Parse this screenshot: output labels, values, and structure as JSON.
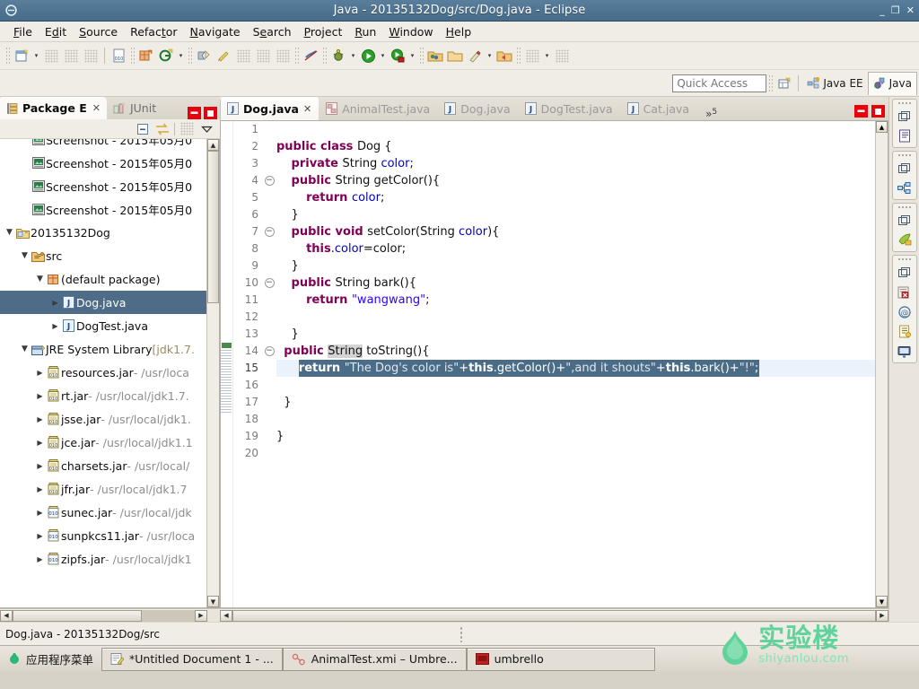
{
  "window": {
    "title": "Java - 20135132Dog/src/Dog.java - Eclipse",
    "app_icon": "eclipse-icon",
    "buttons": {
      "minimize": "_",
      "restore": "❐",
      "close": "✕"
    }
  },
  "menubar": {
    "items": [
      {
        "label": "File",
        "mnemonic": "F"
      },
      {
        "label": "Edit",
        "mnemonic": "E"
      },
      {
        "label": "Source",
        "mnemonic": "S"
      },
      {
        "label": "Refactor",
        "mnemonic": "R"
      },
      {
        "label": "Navigate",
        "mnemonic": "N"
      },
      {
        "label": "Search",
        "mnemonic": "e"
      },
      {
        "label": "Project",
        "mnemonic": "P"
      },
      {
        "label": "Run",
        "mnemonic": "R"
      },
      {
        "label": "Window",
        "mnemonic": "W"
      },
      {
        "label": "Help",
        "mnemonic": "H"
      }
    ]
  },
  "toolbar": {
    "groups": [
      {
        "items": [
          {
            "name": "new-wizard-button",
            "icon": "new-file-icon",
            "arrow": true
          },
          {
            "name": "save-button",
            "icon": "save-icon-disabled",
            "arrow": false
          },
          {
            "name": "save-all-button",
            "icon": "save-all-icon-disabled",
            "arrow": false
          },
          {
            "name": "print-button",
            "icon": "print-icon-disabled",
            "arrow": false
          }
        ]
      },
      {
        "items": [
          {
            "name": "toggle-java-annotations-button",
            "icon": "binary-doc-icon",
            "arrow": false
          }
        ]
      },
      {
        "items": [
          {
            "name": "new-java-package-button",
            "icon": "new-package-icon",
            "arrow": false
          },
          {
            "name": "new-java-class-button",
            "icon": "new-class-icon",
            "arrow": true
          }
        ]
      },
      {
        "items": [
          {
            "name": "open-type-button",
            "icon": "open-type-icon",
            "arrow": false
          },
          {
            "name": "quick-fix-button",
            "icon": "quickfix-icon",
            "arrow": false
          },
          {
            "name": "search-button",
            "icon": "search-icon-disabled",
            "arrow": false
          },
          {
            "name": "toggle-mark-occurrences-button",
            "icon": "mark-occurrences-icon-disabled",
            "arrow": false
          },
          {
            "name": "last-edit-location-button",
            "icon": "last-edit-icon-disabled",
            "arrow": false
          }
        ]
      },
      {
        "items": [
          {
            "name": "skip-all-breakpoints-button",
            "icon": "skip-breakpoints-icon",
            "arrow": false
          }
        ]
      },
      {
        "items": [
          {
            "name": "debug-button",
            "icon": "debug-bug-icon",
            "arrow": true
          },
          {
            "name": "run-button",
            "icon": "run-green-play-icon",
            "arrow": true
          },
          {
            "name": "run-external-tools-button",
            "icon": "external-tools-icon",
            "arrow": true
          }
        ]
      },
      {
        "items": [
          {
            "name": "new-folder-button",
            "icon": "new-folder-icon",
            "arrow": false
          },
          {
            "name": "open-folder-button",
            "icon": "open-folder-icon",
            "arrow": false
          },
          {
            "name": "new-umbrello-button",
            "icon": "pencil-icon",
            "arrow": true
          },
          {
            "name": "open-recent-button",
            "icon": "folder-arrow-icon",
            "arrow": false
          }
        ]
      },
      {
        "items": [
          {
            "name": "previous-annotation-button",
            "icon": "prev-annotation-icon-disabled",
            "arrow": true
          },
          {
            "name": "next-annotation-button",
            "icon": "next-annotation-icon-disabled",
            "arrow": false
          }
        ]
      }
    ]
  },
  "quick_access": {
    "placeholder": "Quick Access",
    "value": "",
    "open_perspective_icon": "open-perspective-icon",
    "perspectives": [
      {
        "label": "Java EE",
        "icon": "java-ee-perspective-icon",
        "active": false
      },
      {
        "label": "Java",
        "icon": "java-perspective-icon",
        "active": true
      }
    ]
  },
  "package_explorer": {
    "tabs": [
      {
        "label": "Package E",
        "icon": "package-explorer-icon",
        "active": true,
        "closable": true
      },
      {
        "label": "JUnit",
        "icon": "junit-icon",
        "active": false,
        "closable": false
      }
    ],
    "header_buttons": [
      {
        "name": "minimize-view-button",
        "icon": "minimize-icon"
      },
      {
        "name": "maximize-view-button",
        "icon": "maximize-icon"
      }
    ],
    "view_toolbar": [
      {
        "name": "collapse-all-button",
        "icon": "collapse-all-icon"
      },
      {
        "name": "link-with-editor-button",
        "icon": "link-with-editor-icon"
      },
      {
        "name": "focus-on-active-task-button",
        "icon": "focus-task-icon-disabled"
      },
      {
        "name": "view-menu-button",
        "icon": "chevron-down-icon"
      }
    ],
    "tree": [
      {
        "indent": 1,
        "arrow": "none",
        "icon": "image-file-icon",
        "label": "Screenshot - 2015年05月0",
        "path": "",
        "selected": false,
        "clipped": true
      },
      {
        "indent": 1,
        "arrow": "none",
        "icon": "image-file-icon",
        "label": "Screenshot - 2015年05月0",
        "path": "",
        "selected": false,
        "clipped": true
      },
      {
        "indent": 1,
        "arrow": "none",
        "icon": "image-file-icon",
        "label": "Screenshot - 2015年05月0",
        "path": "",
        "selected": false,
        "clipped": true
      },
      {
        "indent": 1,
        "arrow": "none",
        "icon": "image-file-icon",
        "label": "Screenshot - 2015年05月0",
        "path": "",
        "selected": false,
        "clipped": true
      },
      {
        "indent": 0,
        "arrow": "open",
        "icon": "java-project-icon",
        "label": "20135132Dog",
        "path": "",
        "selected": false
      },
      {
        "indent": 1,
        "arrow": "open",
        "icon": "source-folder-icon",
        "label": "src",
        "path": "",
        "selected": false
      },
      {
        "indent": 2,
        "arrow": "open",
        "icon": "package-icon",
        "label": "(default package)",
        "path": "",
        "selected": false
      },
      {
        "indent": 3,
        "arrow": "closed",
        "icon": "java-file-icon",
        "label": "Dog.java",
        "path": "",
        "selected": true
      },
      {
        "indent": 3,
        "arrow": "closed",
        "icon": "java-file-icon",
        "label": "DogTest.java",
        "path": "",
        "selected": false
      },
      {
        "indent": 1,
        "arrow": "open",
        "icon": "jre-library-icon",
        "label": "JRE System Library",
        "suffix": "[jdk1.7.",
        "path": "",
        "selected": false,
        "clipped": true
      },
      {
        "indent": 2,
        "arrow": "closed",
        "icon": "jar-icon",
        "label": "resources.jar",
        "path": " - /usr/loca",
        "selected": false,
        "clipped": true
      },
      {
        "indent": 2,
        "arrow": "closed",
        "icon": "jar-icon",
        "label": "rt.jar",
        "path": " - /usr/local/jdk1.7.",
        "selected": false,
        "clipped": true
      },
      {
        "indent": 2,
        "arrow": "closed",
        "icon": "jar-icon",
        "label": "jsse.jar",
        "path": " - /usr/local/jdk1.",
        "selected": false,
        "clipped": true
      },
      {
        "indent": 2,
        "arrow": "closed",
        "icon": "jar-icon",
        "label": "jce.jar",
        "path": " - /usr/local/jdk1.1",
        "selected": false,
        "clipped": true
      },
      {
        "indent": 2,
        "arrow": "closed",
        "icon": "jar-icon",
        "label": "charsets.jar",
        "path": " - /usr/local/",
        "selected": false,
        "clipped": true
      },
      {
        "indent": 2,
        "arrow": "closed",
        "icon": "jar-icon",
        "label": "jfr.jar",
        "path": " - /usr/local/jdk1.7",
        "selected": false,
        "clipped": true
      },
      {
        "indent": 2,
        "arrow": "closed",
        "icon": "jar-plain-icon",
        "label": "sunec.jar",
        "path": " - /usr/local/jdk",
        "selected": false,
        "clipped": true
      },
      {
        "indent": 2,
        "arrow": "closed",
        "icon": "jar-plain-icon",
        "label": "sunpkcs11.jar",
        "path": " - /usr/loca",
        "selected": false,
        "clipped": true
      },
      {
        "indent": 2,
        "arrow": "closed",
        "icon": "jar-plain-icon",
        "label": "zipfs.jar",
        "path": " - /usr/local/jdk1",
        "selected": false,
        "clipped": true
      }
    ]
  },
  "editor": {
    "tabs": [
      {
        "label": "Dog.java",
        "icon": "java-file-icon",
        "active": true,
        "closable": true
      },
      {
        "label": "AnimalTest.java",
        "icon": "umbrello-file-icon",
        "active": false,
        "closable": false
      },
      {
        "label": "Dog.java",
        "icon": "java-file-icon",
        "active": false,
        "closable": false
      },
      {
        "label": "DogTest.java",
        "icon": "java-file-icon",
        "active": false,
        "closable": false
      },
      {
        "label": "Cat.java",
        "icon": "java-file-icon",
        "active": false,
        "closable": false
      }
    ],
    "overflow": {
      "chevron": "»",
      "count": "5"
    },
    "header_buttons": [
      {
        "name": "minimize-editor-button",
        "icon": "minimize-icon"
      },
      {
        "name": "maximize-editor-button",
        "icon": "maximize-icon"
      }
    ],
    "line_numbers": [
      "1",
      "2",
      "3",
      "4",
      "5",
      "6",
      "7",
      "8",
      "9",
      "10",
      "11",
      "12",
      "13",
      "14",
      "15",
      "16",
      "17",
      "18",
      "19",
      "20"
    ],
    "fold_lines": [
      4,
      7,
      10,
      14
    ],
    "selected_line": 15,
    "code_lines": [
      {
        "n": 1,
        "tokens": []
      },
      {
        "n": 2,
        "tokens": [
          {
            "t": "public class ",
            "c": "kw"
          },
          {
            "t": "Dog {",
            "c": ""
          }
        ]
      },
      {
        "n": 3,
        "tokens": [
          {
            "t": "    ",
            "c": ""
          },
          {
            "t": "private ",
            "c": "kw"
          },
          {
            "t": "String ",
            "c": ""
          },
          {
            "t": "color",
            "c": "fld"
          },
          {
            "t": ";",
            "c": ""
          }
        ]
      },
      {
        "n": 4,
        "tokens": [
          {
            "t": "    ",
            "c": ""
          },
          {
            "t": "public ",
            "c": "kw"
          },
          {
            "t": "String getColor(){",
            "c": ""
          }
        ]
      },
      {
        "n": 5,
        "tokens": [
          {
            "t": "        ",
            "c": ""
          },
          {
            "t": "return ",
            "c": "kw"
          },
          {
            "t": "color",
            "c": "fld"
          },
          {
            "t": ";",
            "c": ""
          }
        ]
      },
      {
        "n": 6,
        "tokens": [
          {
            "t": "    }",
            "c": ""
          }
        ]
      },
      {
        "n": 7,
        "tokens": [
          {
            "t": "    ",
            "c": ""
          },
          {
            "t": "public void ",
            "c": "kw"
          },
          {
            "t": "setColor(String ",
            "c": ""
          },
          {
            "t": "color",
            "c": "fld"
          },
          {
            "t": "){",
            "c": ""
          }
        ]
      },
      {
        "n": 8,
        "tokens": [
          {
            "t": "        ",
            "c": ""
          },
          {
            "t": "this",
            "c": "kw"
          },
          {
            "t": ".",
            "c": ""
          },
          {
            "t": "color",
            "c": "fld"
          },
          {
            "t": "=color;",
            "c": ""
          }
        ]
      },
      {
        "n": 9,
        "tokens": [
          {
            "t": "    }",
            "c": ""
          }
        ]
      },
      {
        "n": 10,
        "tokens": [
          {
            "t": "    ",
            "c": ""
          },
          {
            "t": "public ",
            "c": "kw"
          },
          {
            "t": "String bark(){",
            "c": ""
          }
        ]
      },
      {
        "n": 11,
        "tokens": [
          {
            "t": "        ",
            "c": ""
          },
          {
            "t": "return ",
            "c": "kw"
          },
          {
            "t": "\"wangwang\"",
            "c": "str"
          },
          {
            "t": ";",
            "c": ""
          }
        ]
      },
      {
        "n": 12,
        "tokens": []
      },
      {
        "n": 13,
        "tokens": [
          {
            "t": "    }",
            "c": ""
          }
        ]
      },
      {
        "n": 14,
        "tokens": [
          {
            "t": "  ",
            "c": ""
          },
          {
            "t": "public ",
            "c": "kw"
          },
          {
            "t": "String",
            "c": "occ"
          },
          {
            "t": " toString(){",
            "c": ""
          }
        ]
      },
      {
        "n": 15,
        "selected": true,
        "tokens": [
          {
            "t": "      ",
            "c": ""
          },
          {
            "t": "return ",
            "c": "kw"
          },
          {
            "t": "\"The Dog's color is\"",
            "c": "str"
          },
          {
            "t": "+",
            "c": ""
          },
          {
            "t": "this",
            "c": "kw"
          },
          {
            "t": ".getColor()+",
            "c": ""
          },
          {
            "t": "\",and it shouts\"",
            "c": "str"
          },
          {
            "t": "+",
            "c": ""
          },
          {
            "t": "this",
            "c": "kw"
          },
          {
            "t": ".bark()+",
            "c": ""
          },
          {
            "t": "\"!\"",
            "c": "str"
          },
          {
            "t": ";",
            "c": ""
          }
        ]
      },
      {
        "n": 16,
        "tokens": []
      },
      {
        "n": 17,
        "tokens": [
          {
            "t": "  }",
            "c": ""
          }
        ]
      },
      {
        "n": 18,
        "tokens": []
      },
      {
        "n": 19,
        "tokens": [
          {
            "t": "}",
            "c": ""
          }
        ]
      },
      {
        "n": 20,
        "tokens": []
      }
    ]
  },
  "right_strip": {
    "groups": [
      {
        "name": "minimized-outline-group",
        "restore_icon": "restore-icon",
        "icons": [
          "outline-view-icon"
        ]
      },
      {
        "name": "minimized-hierarchy-group",
        "restore_icon": "restore-icon",
        "icons": [
          "type-hierarchy-icon"
        ]
      },
      {
        "name": "minimized-mylyn-group",
        "restore_icon": "restore-icon",
        "icons": [
          "task-list-icon"
        ]
      },
      {
        "name": "minimized-problems-group",
        "restore_icon": "restore-icon",
        "icons": [
          "problems-view-icon",
          "javadoc-view-icon",
          "declaration-view-icon",
          "console-view-icon"
        ]
      }
    ]
  },
  "status_bar": {
    "text": "Dog.java - 20135132Dog/src"
  },
  "taskbar": {
    "items": [
      {
        "label": "应用程序菜单",
        "icon": "applications-menu-icon",
        "active": false
      },
      {
        "label": "*Untitled Document 1 - ...",
        "icon": "gedit-icon",
        "active": true
      },
      {
        "label": "AnimalTest.xmi – Umbre...",
        "icon": "umbrello-icon",
        "active": true
      },
      {
        "label": "umbrello",
        "icon": "umbrello-window-icon",
        "active": true
      }
    ]
  },
  "watermark": {
    "big": "实验楼",
    "small": "shiyanlou.com",
    "color": "#5fd39a"
  },
  "colors": {
    "title_bar": "#4d7290",
    "chrome": "#f0ede6",
    "tree_selection": "#4e6c88",
    "code_selection": "#4a6c87",
    "keyword": "#7f0055",
    "field": "#0000c0",
    "string": "#2a00ff",
    "red_button": "#e8000d",
    "watermark_green": "#5fd39a"
  }
}
